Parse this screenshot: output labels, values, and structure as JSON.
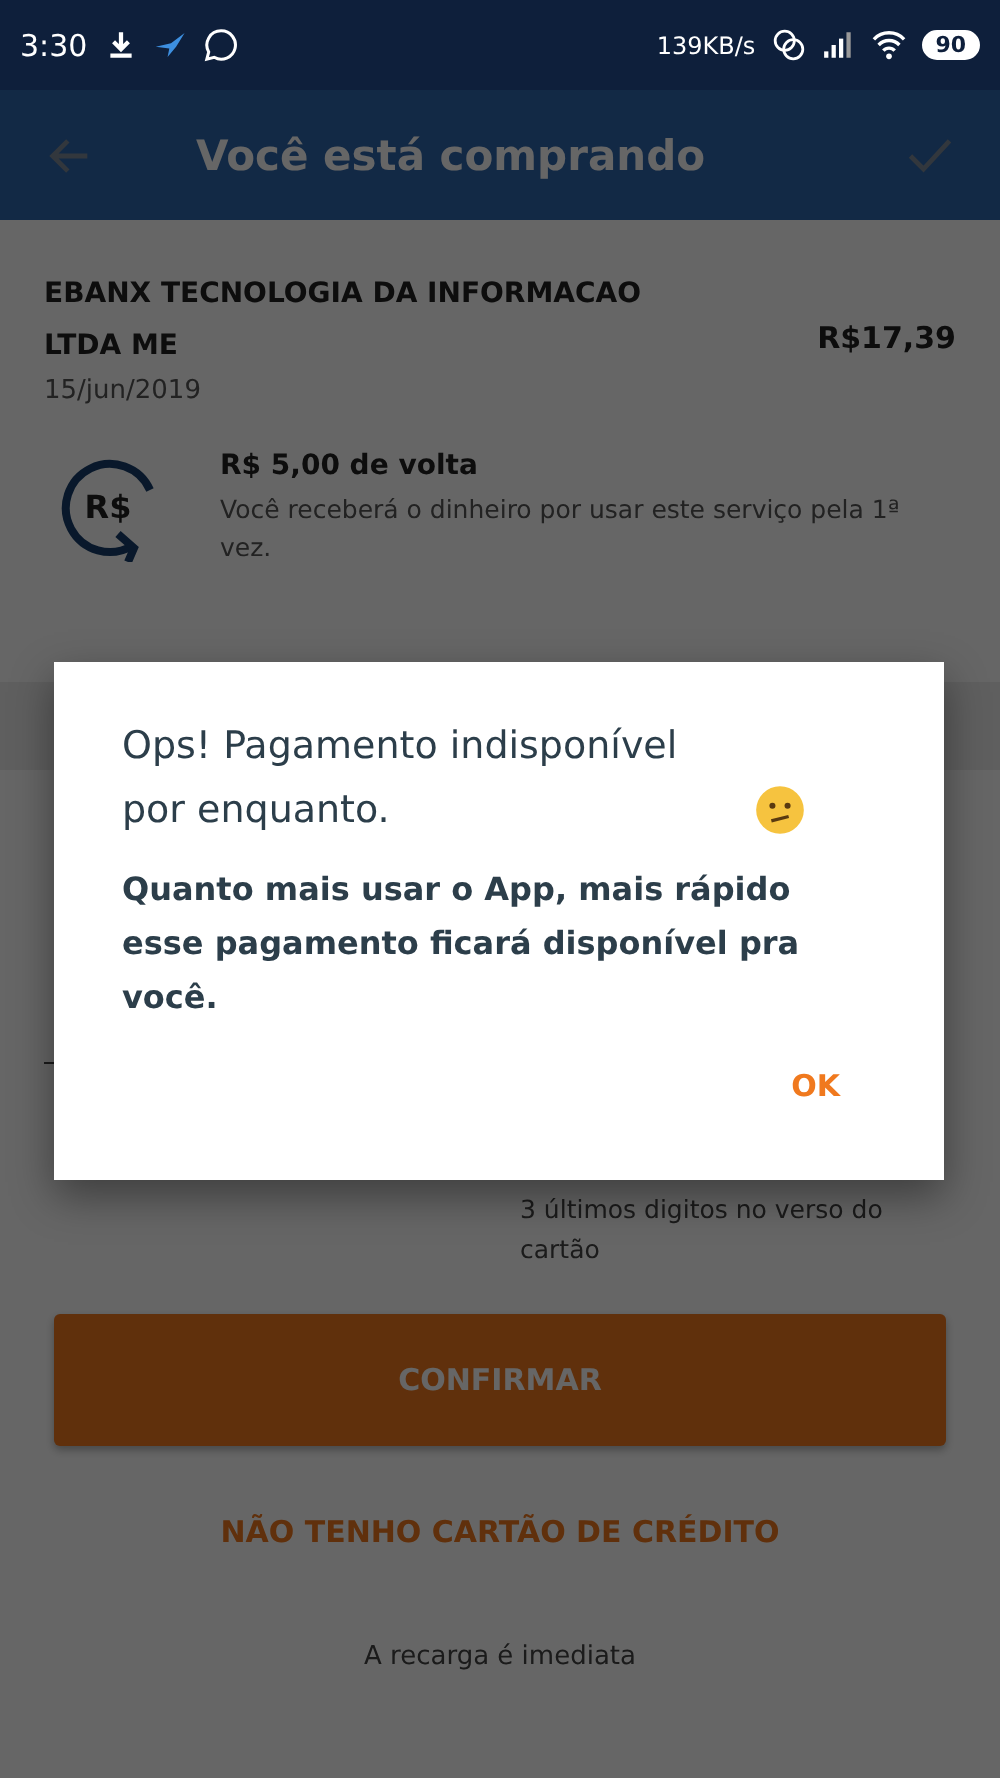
{
  "status_bar": {
    "time": "3:30",
    "speed": "139KB/s",
    "battery": "90"
  },
  "app_bar": {
    "title": "Você está comprando"
  },
  "purchase": {
    "merchant": "EBANX TECNOLOGIA DA INFORMACAO LTDA ME",
    "date": "15/jun/2019",
    "amount": "R$17,39"
  },
  "cashback": {
    "icon_text": "R$",
    "title": "R$ 5,00 de volta",
    "description": "Você receberá o dinheiro por usar este serviço pela 1ª vez."
  },
  "cvv_hint": "3 últimos digitos no verso do cartão",
  "confirm_button": "CONFIRMAR",
  "no_card_link": "NÃO TENHO CARTÃO DE CRÉDITO",
  "footer": "A recarga é imediata",
  "dialog": {
    "title": "Ops! Pagamento indisponível por enquanto.",
    "message": "Quanto mais usar o App, mais rápido esse pagamento ficará disponível pra você.",
    "button": "OK"
  }
}
